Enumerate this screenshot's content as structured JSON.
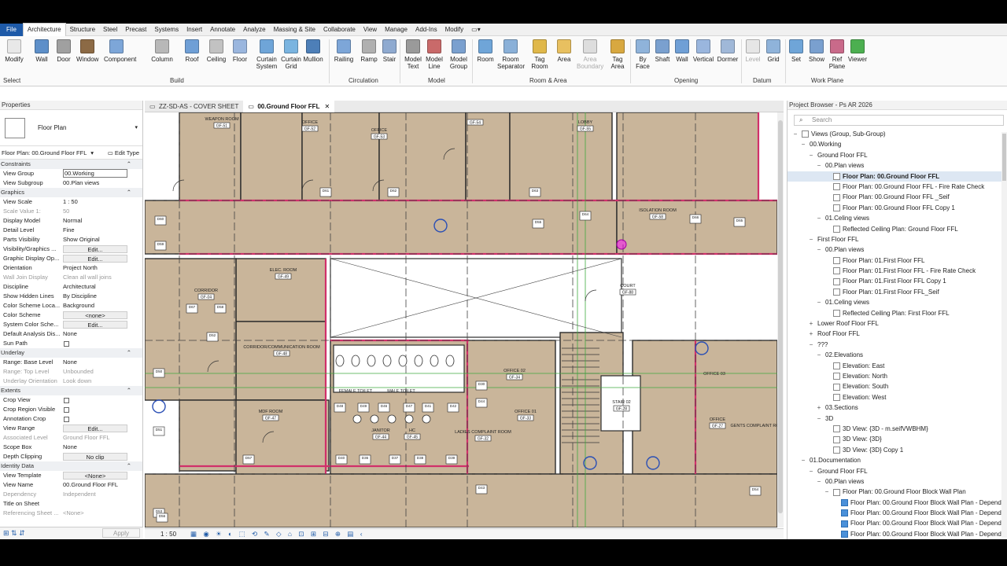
{
  "menubar": {
    "tabs": [
      "File",
      "Architecture",
      "Structure",
      "Steel",
      "Precast",
      "Systems",
      "Insert",
      "Annotate",
      "Analyze",
      "Massing & Site",
      "Collaborate",
      "View",
      "Manage",
      "Add-Ins",
      "Modify"
    ],
    "active": "Architecture"
  },
  "ribbon": {
    "select_label": "Select",
    "modify": "Modify",
    "build": [
      "Wall",
      "Door",
      "Window",
      "Component",
      "Column",
      "Roof",
      "Ceiling",
      "Floor",
      "Curtain System",
      "Curtain Grid",
      "Mullion"
    ],
    "build_label": "Build",
    "circulation": [
      "Railing",
      "Ramp",
      "Stair"
    ],
    "circulation_label": "Circulation",
    "model": [
      "Model Text",
      "Model Line",
      "Model Group"
    ],
    "model_label": "Model",
    "room_area": [
      "Room",
      "Room Separator",
      "Tag Room",
      "Area",
      "Area Boundary",
      "Tag Area"
    ],
    "room_area_label": "Room & Area",
    "opening": [
      "By Face",
      "Shaft",
      "Wall",
      "Vertical",
      "Dormer"
    ],
    "opening_label": "Opening",
    "datum": [
      "Level",
      "Grid"
    ],
    "datum_label": "Datum",
    "workplane": [
      "Set",
      "Show",
      "Ref Plane",
      "Viewer"
    ],
    "workplane_label": "Work Plane"
  },
  "properties": {
    "title": "Properties",
    "type_name": "Floor Plan",
    "instance": "Floor Plan: 00.Ground Floor FFL",
    "edit_type": "Edit Type",
    "sections": {
      "constraints": "Constraints",
      "graphics": "Graphics",
      "underlay": "Underlay",
      "extents": "Extents",
      "identity": "Identity Data"
    },
    "constraints": [
      {
        "k": "View Group",
        "v": "00.Working",
        "input": true
      },
      {
        "k": "View Subgroup",
        "v": "00.Plan views"
      }
    ],
    "graphics": [
      {
        "k": "View Scale",
        "v": "1 : 50"
      },
      {
        "k": "Scale Value    1:",
        "v": "50",
        "dim": true
      },
      {
        "k": "Display Model",
        "v": "Normal"
      },
      {
        "k": "Detail Level",
        "v": "Fine"
      },
      {
        "k": "Parts Visibility",
        "v": "Show Original"
      },
      {
        "k": "Visibility/Graphics ...",
        "v": "Edit...",
        "btn": true
      },
      {
        "k": "Graphic Display Op...",
        "v": "Edit...",
        "btn": true
      },
      {
        "k": "Orientation",
        "v": "Project North"
      },
      {
        "k": "Wall Join Display",
        "v": "Clean all wall joins",
        "dim": true
      },
      {
        "k": "Discipline",
        "v": "Architectural"
      },
      {
        "k": "Show Hidden Lines",
        "v": "By Discipline"
      },
      {
        "k": "Color Scheme Loca...",
        "v": "Background"
      },
      {
        "k": "Color Scheme",
        "v": "<none>",
        "btn": true
      },
      {
        "k": "System Color Sche...",
        "v": "Edit...",
        "btn": true
      },
      {
        "k": "Default Analysis Dis...",
        "v": "None"
      },
      {
        "k": "Sun Path",
        "v": "",
        "cb": true
      }
    ],
    "underlay": [
      {
        "k": "Range: Base Level",
        "v": "None"
      },
      {
        "k": "Range: Top Level",
        "v": "Unbounded",
        "dim": true
      },
      {
        "k": "Underlay Orientation",
        "v": "Look down",
        "dim": true
      }
    ],
    "extents": [
      {
        "k": "Crop View",
        "v": "",
        "cb": true
      },
      {
        "k": "Crop Region Visible",
        "v": "",
        "cb": true
      },
      {
        "k": "Annotation Crop",
        "v": "",
        "cb": true
      },
      {
        "k": "View Range",
        "v": "Edit...",
        "btn": true
      },
      {
        "k": "Associated Level",
        "v": "Ground Floor FFL",
        "dim": true
      },
      {
        "k": "Scope Box",
        "v": "None"
      },
      {
        "k": "Depth Clipping",
        "v": "No clip",
        "btn": true
      }
    ],
    "identity": [
      {
        "k": "View Template",
        "v": "<None>",
        "btn": true
      },
      {
        "k": "View Name",
        "v": "00.Ground Floor FFL"
      },
      {
        "k": "Dependency",
        "v": "Independent",
        "dim": true
      },
      {
        "k": "Title on Sheet",
        "v": ""
      },
      {
        "k": "Referencing Sheet ...",
        "v": "<None>",
        "dim": true
      }
    ],
    "apply": "Apply"
  },
  "view_tabs": [
    {
      "label": "ZZ-SD-AS - COVER SHEET",
      "active": false
    },
    {
      "label": "00.Ground Floor FFL",
      "active": true
    }
  ],
  "view_control": {
    "scale": "1 : 50"
  },
  "plan": {
    "rooms": [
      {
        "name": "WEAPON ROOM",
        "tag": "GF-51"
      },
      {
        "name": "OFFICE",
        "tag": "GF-52"
      },
      {
        "name": "OFFICE",
        "tag": "GF-53"
      },
      {
        "name": "",
        "tag": "GF-54"
      },
      {
        "name": "LOBBY",
        "tag": "GF-55"
      },
      {
        "name": "ISOLATION ROOM",
        "tag": "GF-58"
      },
      {
        "name": "ELEC. ROOM",
        "tag": "GF-49"
      },
      {
        "name": "CORRIDOR",
        "tag": "GF-04"
      },
      {
        "name": "COURT",
        "tag": "GF-88"
      },
      {
        "name": "CORRIDOR/COMMUNICATION ROOM",
        "tag": "GF-48"
      },
      {
        "name": "OFFICE 02",
        "tag": "GF-34"
      },
      {
        "name": "OFFICE 01",
        "tag": "GF-33"
      },
      {
        "name": "OFFICE 03",
        "tag": ""
      },
      {
        "name": "OFFICE",
        "tag": "GF-27"
      },
      {
        "name": "STAIR 02",
        "tag": "GF-28"
      },
      {
        "name": "MDF ROOM",
        "tag": "GF-47"
      },
      {
        "name": "JANITOR",
        "tag": "GF-44"
      },
      {
        "name": "HC",
        "tag": "GF-45"
      },
      {
        "name": "FEMALE TOILET",
        "tag": ""
      },
      {
        "name": "MALE TOILET",
        "tag": ""
      },
      {
        "name": "LADIES COMPLAINT ROOM",
        "tag": "GF-32"
      },
      {
        "name": "GENTS COMPLAINT ROOM",
        "tag": ""
      }
    ],
    "door_tags": [
      "D60",
      "D61",
      "D62",
      "D63",
      "D64",
      "D65",
      "D66",
      "D67",
      "D58",
      "D59",
      "D50",
      "D51",
      "D52",
      "D48",
      "D49",
      "D46",
      "D47",
      "D41",
      "D42",
      "D40",
      "D36",
      "D37",
      "D38",
      "D39",
      "D30",
      "D44",
      "D43",
      "D54",
      "D53",
      "D57",
      "D56",
      "D55"
    ]
  },
  "browser": {
    "title": "Project Browser - Ps AR 2026",
    "search": "Search",
    "items": [
      {
        "d": 0,
        "t": "-",
        "label": "Views (Group, Sub-Group)",
        "icon": true
      },
      {
        "d": 1,
        "t": "-",
        "label": "00.Working"
      },
      {
        "d": 2,
        "t": "-",
        "label": "Ground Floor FFL"
      },
      {
        "d": 3,
        "t": "-",
        "label": "00.Plan views"
      },
      {
        "d": 4,
        "t": "",
        "label": "Floor Plan: 00.Ground Floor FFL",
        "icon": true,
        "sel": true
      },
      {
        "d": 4,
        "t": "",
        "label": "Floor Plan: 00.Ground Floor FFL - Fire Rate Check",
        "icon": true
      },
      {
        "d": 4,
        "t": "",
        "label": "Floor Plan: 00.Ground Floor FFL _Seif",
        "icon": true
      },
      {
        "d": 4,
        "t": "",
        "label": "Floor Plan: 00.Ground Floor FFL Copy 1",
        "icon": true
      },
      {
        "d": 3,
        "t": "-",
        "label": "01.Celing views"
      },
      {
        "d": 4,
        "t": "",
        "label": "Reflected Ceiling Plan: Ground Floor FFL",
        "icon": true
      },
      {
        "d": 2,
        "t": "-",
        "label": "First Floor FFL"
      },
      {
        "d": 3,
        "t": "-",
        "label": "00.Plan views"
      },
      {
        "d": 4,
        "t": "",
        "label": "Floor Plan: 01.First Floor FFL",
        "icon": true
      },
      {
        "d": 4,
        "t": "",
        "label": "Floor Plan: 01.First Floor FFL - Fire Rate Check",
        "icon": true
      },
      {
        "d": 4,
        "t": "",
        "label": "Floor Plan: 01.First Floor FFL Copy 1",
        "icon": true
      },
      {
        "d": 4,
        "t": "",
        "label": "Floor Plan: 01.First Floor FFL_Seif",
        "icon": true
      },
      {
        "d": 3,
        "t": "-",
        "label": "01.Celing views"
      },
      {
        "d": 4,
        "t": "",
        "label": "Reflected Ceiling Plan: First Floor FFL",
        "icon": true
      },
      {
        "d": 2,
        "t": "+",
        "label": "Lower Roof Floor FFL"
      },
      {
        "d": 2,
        "t": "+",
        "label": "Roof Floor FFL"
      },
      {
        "d": 2,
        "t": "-",
        "label": "???"
      },
      {
        "d": 3,
        "t": "-",
        "label": "02.Elevations"
      },
      {
        "d": 4,
        "t": "",
        "label": "Elevation: East",
        "icon": true
      },
      {
        "d": 4,
        "t": "",
        "label": "Elevation: North",
        "icon": true
      },
      {
        "d": 4,
        "t": "",
        "label": "Elevation: South",
        "icon": true
      },
      {
        "d": 4,
        "t": "",
        "label": "Elevation: West",
        "icon": true
      },
      {
        "d": 3,
        "t": "+",
        "label": "03.Sections"
      },
      {
        "d": 3,
        "t": "-",
        "label": "3D"
      },
      {
        "d": 4,
        "t": "",
        "label": "3D View: {3D - m.seifVWBHM}",
        "icon": true
      },
      {
        "d": 4,
        "t": "",
        "label": "3D View: {3D}",
        "icon": true
      },
      {
        "d": 4,
        "t": "",
        "label": "3D View: {3D} Copy 1",
        "icon": true
      },
      {
        "d": 1,
        "t": "-",
        "label": "01.Documentation"
      },
      {
        "d": 2,
        "t": "-",
        "label": "Ground Floor FFL"
      },
      {
        "d": 3,
        "t": "-",
        "label": "00.Plan views"
      },
      {
        "d": 4,
        "t": "-",
        "label": "Floor Plan: 00.Ground Floor Block Wall Plan",
        "icon": true
      },
      {
        "d": 5,
        "t": "",
        "label": "Floor Plan: 00.Ground Floor Block Wall Plan - Depend",
        "icon": true,
        "blue": true
      },
      {
        "d": 5,
        "t": "",
        "label": "Floor Plan: 00.Ground Floor Block Wall Plan - Depend",
        "icon": true,
        "blue": true
      },
      {
        "d": 5,
        "t": "",
        "label": "Floor Plan: 00.Ground Floor Block Wall Plan - Depend",
        "icon": true,
        "blue": true
      },
      {
        "d": 5,
        "t": "",
        "label": "Floor Plan: 00.Ground Floor Block Wall Plan - Depend",
        "icon": true,
        "blue": true
      }
    ]
  },
  "colors": {
    "wall": "#c9b59a",
    "wall_edge": "#2b2b2b",
    "fire": "#d0306a",
    "grid": "#404040",
    "green": "#3faa3f",
    "accent": "#1e5aa8"
  }
}
